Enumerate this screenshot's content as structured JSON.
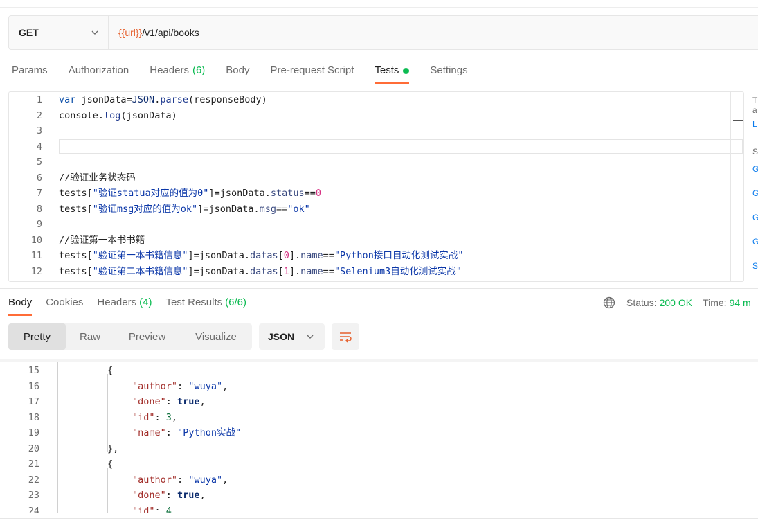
{
  "request": {
    "method": "GET",
    "url_var": "{{url}}",
    "url_path": "/v1/api/books"
  },
  "request_tabs": [
    {
      "label": "Params",
      "count": ""
    },
    {
      "label": "Authorization",
      "count": ""
    },
    {
      "label": "Headers",
      "count": "(6)"
    },
    {
      "label": "Body",
      "count": ""
    },
    {
      "label": "Pre-request Script",
      "count": ""
    },
    {
      "label": "Tests",
      "count": ""
    },
    {
      "label": "Settings",
      "count": ""
    }
  ],
  "editor": {
    "line_numbers": [
      "1",
      "2",
      "3",
      "4",
      "5",
      "6",
      "7",
      "8",
      "9",
      "10",
      "11",
      "12"
    ]
  },
  "snippets": {
    "items": [
      "T",
      "a",
      "L",
      "S",
      "G",
      "G",
      "G",
      "G",
      "S"
    ]
  },
  "response_tabs": [
    {
      "label": "Body",
      "count": ""
    },
    {
      "label": "Cookies",
      "count": ""
    },
    {
      "label": "Headers",
      "count": "(4)"
    },
    {
      "label": "Test Results",
      "count": "(6/6)"
    }
  ],
  "status": {
    "status_label": "Status:",
    "status_value": "200 OK",
    "time_label": "Time:",
    "time_value": "94 m"
  },
  "view_modes": [
    "Pretty",
    "Raw",
    "Preview",
    "Visualize"
  ],
  "format": "JSON",
  "response_lines": {
    "line_numbers": [
      "15",
      "16",
      "17",
      "18",
      "19",
      "20",
      "21",
      "22",
      "23",
      "24"
    ],
    "book_a": {
      "author": "wuya",
      "done": "true",
      "id": "3",
      "name": "Python实战"
    },
    "book_b": {
      "author": "wuya",
      "done": "true",
      "id": "4"
    }
  },
  "colors": {
    "accent": "#ff6c37",
    "success": "#0cbb52",
    "url_variable": "#e6602d"
  }
}
